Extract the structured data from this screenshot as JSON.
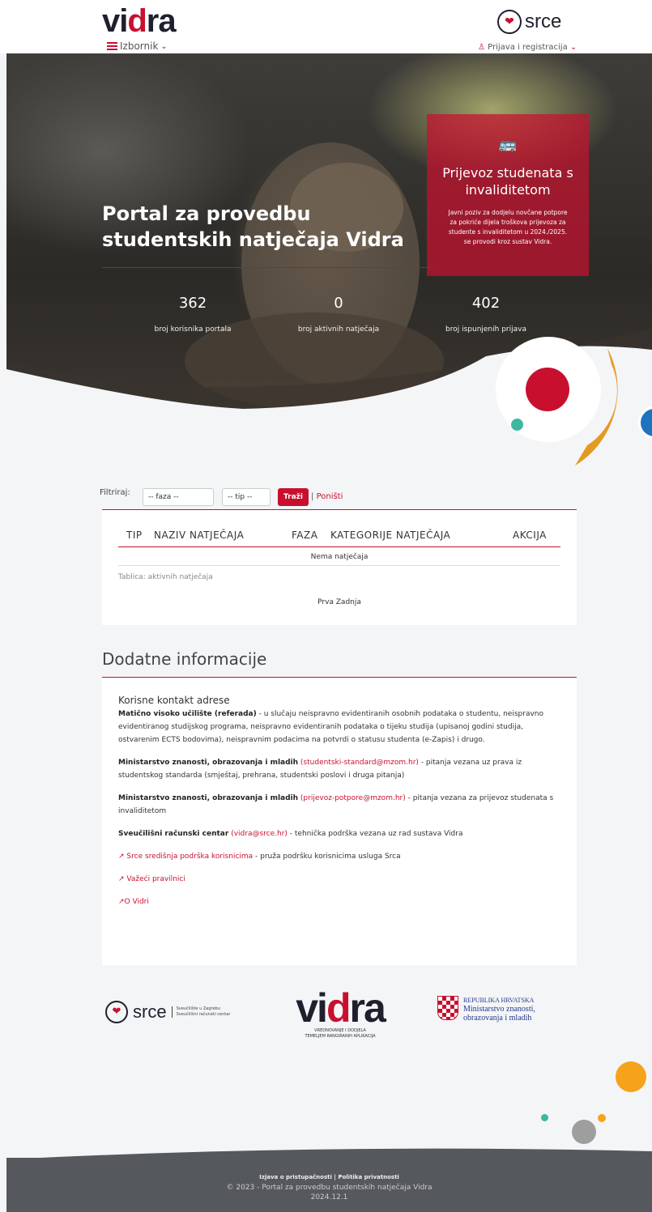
{
  "header": {
    "logo_text_1": "vi",
    "logo_text_accent": "d",
    "logo_text_2": "ra",
    "menu_label": "Izbornik",
    "srce_logo": "srce",
    "login_label": "Prijava i registracija"
  },
  "hero": {
    "title": "Portal za provedbu studentskih natječaja Vidra",
    "stats": [
      {
        "value": "362",
        "label": "broj korisnika portala"
      },
      {
        "value": "0",
        "label": "broj aktivnih natječaja"
      },
      {
        "value": "402",
        "label": "broj ispunjenih prijava"
      }
    ],
    "promo": {
      "icon": "bus-icon",
      "title": "Prijevoz studenata s invaliditetom",
      "text": "Javni poziv za dodjelu novčane potpore za pokriće dijela troškova prijevoza za studente s invaliditetom u 2024./2025. se provodi kroz sustav Vidra."
    }
  },
  "filter": {
    "label": "Filtriraj:",
    "phase_placeholder": "-- faza --",
    "type_placeholder": "-- tip --",
    "search_label": "Traži",
    "reset_label": "Poništi"
  },
  "table": {
    "columns": [
      "TIP",
      "NAZIV NATJEČAJA",
      "FAZA",
      "KATEGORIJE NATJEČAJA",
      "AKCIJA"
    ],
    "empty_text": "Nema natječaja",
    "caption": "Tablica: aktivnih natječaja",
    "pager": "Prva Zadnja"
  },
  "info": {
    "title": "Dodatne informacije",
    "subtitle": "Korisne kontakt adrese",
    "p1_bold": "Matično visoko učilište (referada)",
    "p1_text": " - u slučaju neispravno evidentiranih osobnih podataka o studentu, neispravno evidentiranog studijskog programa, neispravno evidentiranih podataka o tijeku studija (upisanoj godini studija, ostvarenim ECTS bodovima), neispravnim podacima na potvrdi o statusu studenta (e-Zapis) i drugo.",
    "p2_bold": "Ministarstvo znanosti, obrazovanja i mladih",
    "p2_link": "(studentski-standard@mzom.hr)",
    "p2_text": " - pitanja vezana uz prava iz studentskog standarda (smještaj, prehrana, studentski poslovi i druga pitanja)",
    "p3_bold": "Ministarstvo znanosti, obrazovanja i mladih",
    "p3_link": "(prijevoz-potpore@mzom.hr)",
    "p3_text": " - pitanja vezana za prijevoz studenata s invaliditetom",
    "p4_bold": "Sveučilišni računski centar",
    "p4_link": "(vidra@srce.hr)",
    "p4_text": " - tehnička podrška vezana uz rad sustava Vidra",
    "link1": "Srce središnja podrška korisnicima",
    "link1_text": " - pruža podršku korisnicima usluga Srca",
    "link2": "Važeći pravilnici",
    "link3": "O Vidri"
  },
  "logos": {
    "srce": "srce",
    "srce_sub1": "Sveučilište u Zagrebu",
    "srce_sub2": "Sveučilišni računski centar",
    "vidra_1": "vi",
    "vidra_accent": "d",
    "vidra_2": "ra",
    "vidra_sub1": "VREDNOVANJE I DODJELA",
    "vidra_sub2": "TEMELJEM RANGIRANIH APLIKACIJA",
    "rh_1": "REPUBLIKA HRVATSKA",
    "rh_2": "Ministarstvo znanosti,",
    "rh_3": "obrazovanja i mladih"
  },
  "footer": {
    "accessibility": "Izjava o pristupačnosti",
    "privacy": "Politika privatnosti",
    "copyright": "© 2023 - Portal za provedbu studentskih natječaja Vidra",
    "version": "2024.12.1"
  },
  "colors": {
    "accent": "#c8102e",
    "orange": "#e39a23",
    "teal": "#3cb7a0",
    "footer_bg": "#55585d"
  }
}
